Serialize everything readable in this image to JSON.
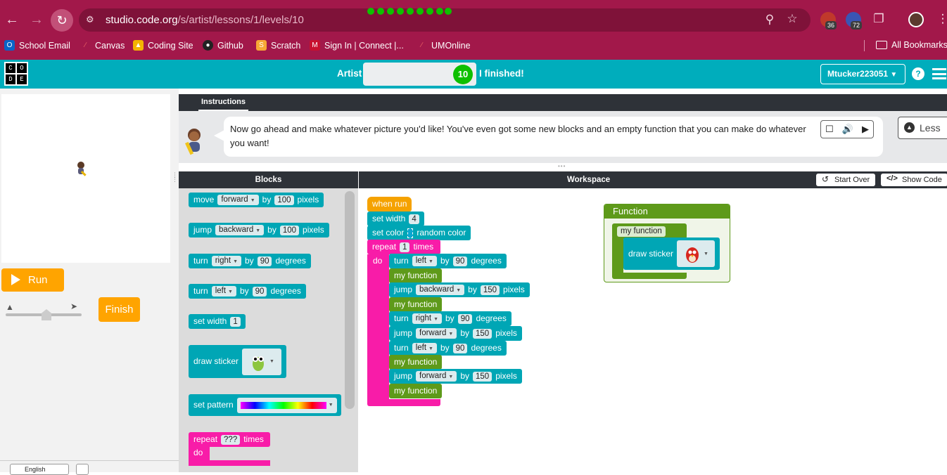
{
  "browser": {
    "url_host": "studio.code.org",
    "url_path": "/s/artist/lessons/1/levels/10",
    "extension_badges": [
      "36",
      "72"
    ],
    "bookmarks": [
      "School Email",
      "Canvas",
      "Coding Site",
      "Github",
      "Scratch",
      "Sign In | Connect |...",
      "UMOnline"
    ],
    "all_bookmarks": "All Bookmarks"
  },
  "header": {
    "logo_letters": [
      "C",
      "O",
      "D",
      "E"
    ],
    "level_title": "Artist",
    "progress_dots": 9,
    "current_level": "10",
    "finished_label": "I finished!",
    "username": "Mtucker223051",
    "help": "?"
  },
  "left": {
    "run_label": "Run",
    "finish_label": "Finish",
    "language": "English"
  },
  "instructions": {
    "tab": "Instructions",
    "text": "Now go ahead and make whatever picture you'd like! You've even got some new blocks and an empty function that you can make do whatever you want!",
    "less_label": "Less"
  },
  "panes": {
    "blocks_title": "Blocks",
    "workspace_title": "Workspace",
    "start_over": "Start Over",
    "show_code": "Show Code"
  },
  "toolbox": {
    "move": {
      "verb": "move",
      "dir": "forward",
      "by": "by",
      "amount": "100",
      "unit": "pixels"
    },
    "jump": {
      "verb": "jump",
      "dir": "backward",
      "by": "by",
      "amount": "100",
      "unit": "pixels"
    },
    "turn_right": {
      "verb": "turn",
      "dir": "right",
      "by": "by",
      "amount": "90",
      "unit": "degrees"
    },
    "turn_left": {
      "verb": "turn",
      "dir": "left",
      "by": "by",
      "amount": "90",
      "unit": "degrees"
    },
    "set_width": {
      "label": "set width",
      "amount": "1"
    },
    "draw_sticker": "draw sticker",
    "set_pattern": "set pattern",
    "repeat": {
      "label": "repeat",
      "amount": "???",
      "unit": "times",
      "do": "do"
    }
  },
  "program": {
    "when_run": "when run",
    "set_width": {
      "label": "set width",
      "amount": "4"
    },
    "set_color": {
      "label": "set color",
      "value": "random color"
    },
    "repeat": {
      "label": "repeat",
      "amount": "1",
      "unit": "times",
      "do": "do"
    },
    "body": [
      {
        "verb": "turn",
        "dir": "left",
        "by": "by",
        "amount": "90",
        "unit": "degrees"
      },
      {
        "call": "my function"
      },
      {
        "verb": "jump",
        "dir": "backward",
        "by": "by",
        "amount": "150",
        "unit": "pixels"
      },
      {
        "call": "my function"
      },
      {
        "verb": "turn",
        "dir": "right",
        "by": "by",
        "amount": "90",
        "unit": "degrees"
      },
      {
        "verb": "jump",
        "dir": "forward",
        "by": "by",
        "amount": "150",
        "unit": "pixels"
      },
      {
        "verb": "turn",
        "dir": "left",
        "by": "by",
        "amount": "90",
        "unit": "degrees"
      },
      {
        "call": "my function"
      },
      {
        "verb": "jump",
        "dir": "forward",
        "by": "by",
        "amount": "150",
        "unit": "pixels"
      },
      {
        "call": "my function"
      }
    ]
  },
  "function_editor": {
    "title": "Function",
    "name": "my function",
    "body_block": "draw sticker"
  },
  "colors": {
    "browser": "#a2184a",
    "header": "#00adbc",
    "action_block": "#00a6b5",
    "loop_block": "#f81ca8",
    "event_block": "#f5a200",
    "function_block": "#5e9a1a",
    "run_button": "#ffa400"
  }
}
